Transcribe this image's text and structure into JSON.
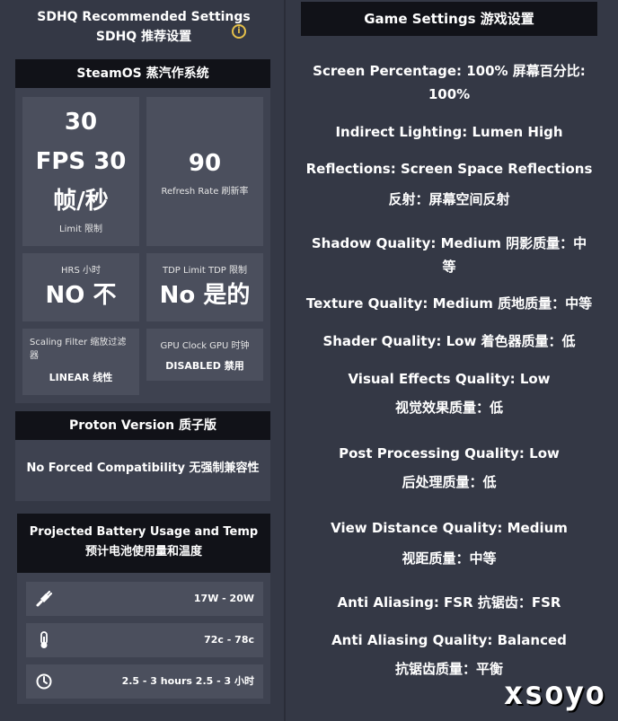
{
  "header": {
    "title_en": "SDHQ Recommended Settings",
    "title_zh": "SDHQ 推荐设置",
    "info_icon": "info-icon"
  },
  "steamos": {
    "title": "SteamOS 蒸汽作系统",
    "fps": {
      "value_line1": "30",
      "value_line2": "FPS 30",
      "value_line3": "帧/秒",
      "label": "Limit 限制"
    },
    "refresh": {
      "value": "90",
      "label": "Refresh Rate 刷新率"
    },
    "hrs": {
      "label": "HRS 小时",
      "value": "NO 不"
    },
    "tdp": {
      "label": "TDP Limit TDP 限制",
      "value": "No 是的"
    },
    "scaling": {
      "label": "Scaling Filter 缩放过滤器",
      "value": "LINEAR 线性"
    },
    "gpu_clock": {
      "label": "GPU Clock GPU 时钟",
      "value": "DISABLED 禁用"
    }
  },
  "proton": {
    "title": "Proton Version 质子版",
    "value": "No Forced Compatibility 无强制兼容性"
  },
  "battery": {
    "title_en": "Projected Battery Usage and Temp",
    "title_zh": "预计电池使用量和温度",
    "rows": [
      {
        "icon": "plug-icon",
        "text": "17W - 20W"
      },
      {
        "icon": "thermometer-icon",
        "text": "72c - 78c"
      },
      {
        "icon": "clock-icon",
        "text": "2.5 - 3 hours 2.5 - 3 小时"
      }
    ]
  },
  "game": {
    "title": "Game Settings 游戏设置",
    "settings": [
      {
        "line1": "Screen Percentage: 100% 屏幕百分比:",
        "line2": "100%"
      },
      {
        "line1": "Indirect Lighting: Lumen High",
        "line2": ""
      },
      {
        "line1": "Reflections: Screen Space Reflections",
        "line2": "反射：屏幕空间反射"
      },
      {
        "line1": "Shadow Quality: Medium 阴影质量：中",
        "line2": "等"
      },
      {
        "line1": "Texture Quality: Medium 质地质量：中等",
        "line2": ""
      },
      {
        "line1": "Shader Quality: Low 着色器质量：低",
        "line2": ""
      },
      {
        "line1": "Visual Effects Quality: Low",
        "line2": "视觉效果质量：低"
      },
      {
        "line1": "Post Processing Quality: Low",
        "line2": "后处理质量：低"
      },
      {
        "line1": "View Distance Quality: Medium",
        "line2": "视距质量：中等"
      },
      {
        "line1": "Anti Aliasing: FSR 抗锯齿：FSR",
        "line2": ""
      },
      {
        "line1": "Anti Aliasing Quality: Balanced",
        "line2": "抗锯齿质量：平衡"
      }
    ]
  },
  "watermark": "xsoyo"
}
